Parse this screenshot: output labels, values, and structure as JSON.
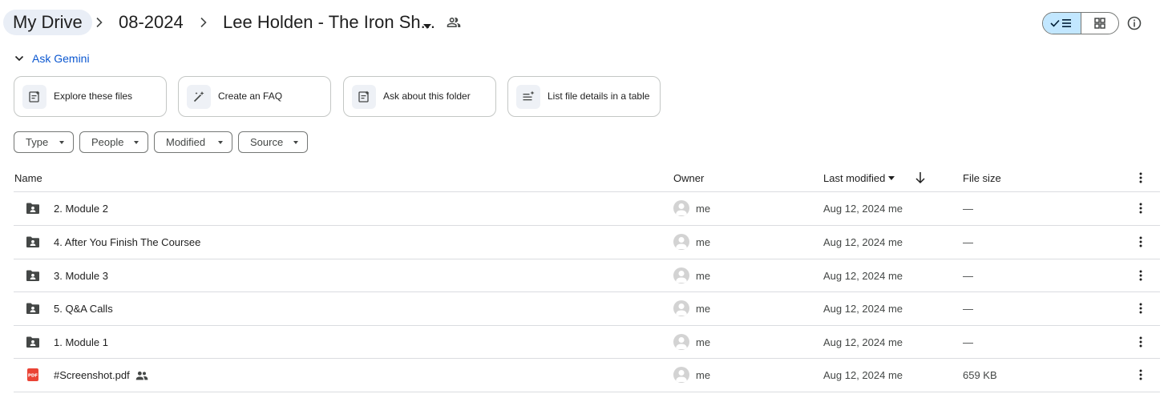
{
  "breadcrumb": {
    "root": "My Drive",
    "parent": "08-2024",
    "current": "Lee Holden - The Iron Sh..."
  },
  "gemini": {
    "label": "Ask Gemini"
  },
  "suggestions": [
    {
      "label": "Explore these files",
      "icon": "doc-sparkle-icon"
    },
    {
      "label": "Create an FAQ",
      "icon": "magic-wand-icon"
    },
    {
      "label": "Ask about this folder",
      "icon": "doc-sparkle-icon"
    },
    {
      "label": "List file details in a table",
      "icon": "list-sparkle-icon"
    }
  ],
  "filters": [
    "Type",
    "People",
    "Modified",
    "Source"
  ],
  "columns": {
    "name": "Name",
    "owner": "Owner",
    "modified": "Last modified",
    "size": "File size"
  },
  "rows": [
    {
      "name": "2. Module 2",
      "type": "shared-folder",
      "owner": "me",
      "modified": "Aug 12, 2024 me",
      "size": "—",
      "shared": false
    },
    {
      "name": "4. After You Finish The Coursee",
      "type": "shared-folder",
      "owner": "me",
      "modified": "Aug 12, 2024 me",
      "size": "—",
      "shared": false
    },
    {
      "name": "3. Module 3",
      "type": "shared-folder",
      "owner": "me",
      "modified": "Aug 12, 2024 me",
      "size": "—",
      "shared": false
    },
    {
      "name": "5. Q&A Calls",
      "type": "shared-folder",
      "owner": "me",
      "modified": "Aug 12, 2024 me",
      "size": "—",
      "shared": false
    },
    {
      "name": "1. Module 1",
      "type": "shared-folder",
      "owner": "me",
      "modified": "Aug 12, 2024 me",
      "size": "—",
      "shared": false
    },
    {
      "name": "#Screenshot.pdf",
      "type": "pdf",
      "owner": "me",
      "modified": "Aug 12, 2024 me",
      "size": "659 KB",
      "shared": true,
      "pdf_badge": "PDF"
    }
  ],
  "colors": {
    "accent": "#0b57d0",
    "selected_toggle": "#c2e7ff",
    "pdf_red": "#ea4335",
    "breadcrumb_chip": "#e9eef6"
  }
}
